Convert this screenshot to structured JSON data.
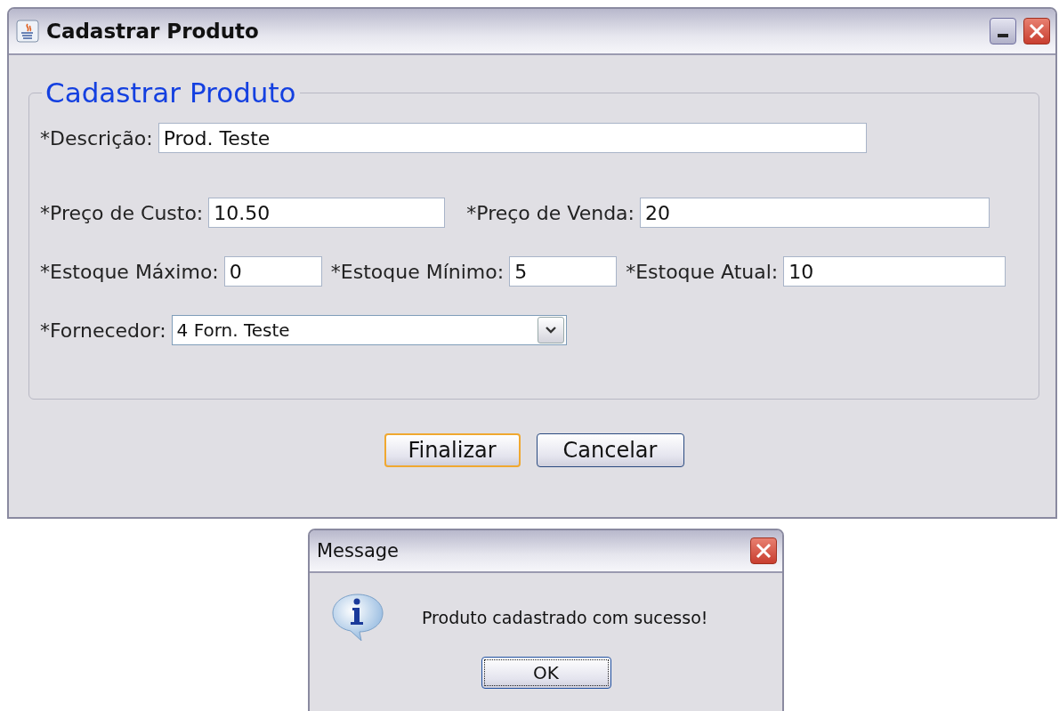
{
  "window": {
    "title": "Cadastrar Produto"
  },
  "form": {
    "title": "Cadastrar Produto",
    "rows": [
      [
        {
          "kind": "text",
          "label": "*Descrição:",
          "value": "Prod. Teste"
        }
      ],
      [
        {
          "kind": "text",
          "label": "*Preço de Custo:",
          "value": "10.50"
        },
        {
          "kind": "text",
          "label": "*Preço de Venda:",
          "value": "20"
        }
      ],
      [
        {
          "kind": "text",
          "label": "*Estoque Máximo:",
          "value": "0"
        },
        {
          "kind": "text",
          "label": "*Estoque Mínimo:",
          "value": "5"
        },
        {
          "kind": "text",
          "label": "*Estoque Atual:",
          "value": "10"
        }
      ],
      [
        {
          "kind": "combo",
          "label": "*Fornecedor:",
          "value": "4 Forn. Teste"
        }
      ]
    ]
  },
  "buttons": [
    {
      "label": "Finalizar",
      "focused": true
    },
    {
      "label": "Cancelar",
      "focused": false
    }
  ],
  "dialog": {
    "title": "Message",
    "message": "Produto cadastrado com sucesso!",
    "buttons": [
      {
        "label": "OK",
        "focused": true
      }
    ]
  }
}
